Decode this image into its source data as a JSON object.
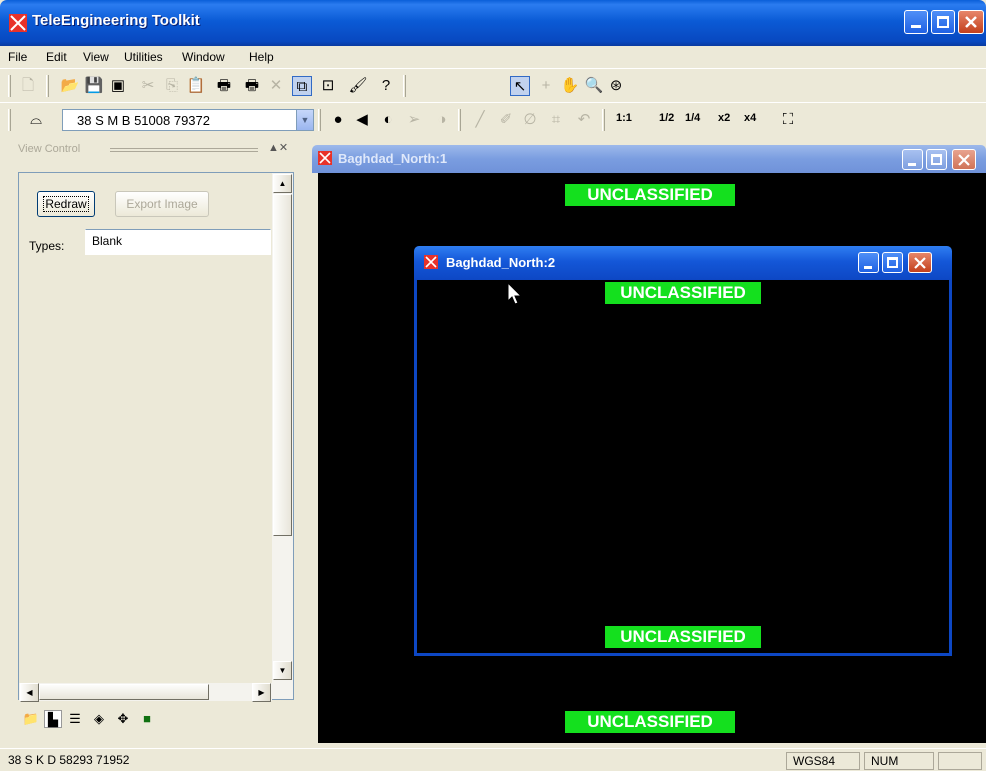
{
  "app": {
    "title": "TeleEngineering Toolkit"
  },
  "menu": [
    "File",
    "Edit",
    "View",
    "Utilities",
    "Window",
    "Help"
  ],
  "toolbar2": {
    "coordinate_value": "38 S M B 51008 79372",
    "zoom_labels": [
      "1:1",
      "1/2",
      "1/4",
      "x2",
      "x4"
    ]
  },
  "view_control": {
    "title": "View Control",
    "redraw_label": "Redraw",
    "export_label": "Export Image",
    "types_label": "Types:",
    "types_value": "Blank"
  },
  "windows": {
    "north1": {
      "title": "Baghdad_North:1",
      "banner_top": "UNCLASSIFIED",
      "banner_bottom": "UNCLASSIFIED"
    },
    "north2": {
      "title": "Baghdad_North:2",
      "banner_top": "UNCLASSIFIED",
      "banner_bottom": "UNCLASSIFIED"
    }
  },
  "statusbar": {
    "coords": "38 S K D 58293 71952",
    "datum": "WGS84",
    "num": "NUM"
  },
  "colors": {
    "banner_green": "#14e01e",
    "titlebar_blue": "#0b5bd6",
    "map_background": "#000000"
  }
}
